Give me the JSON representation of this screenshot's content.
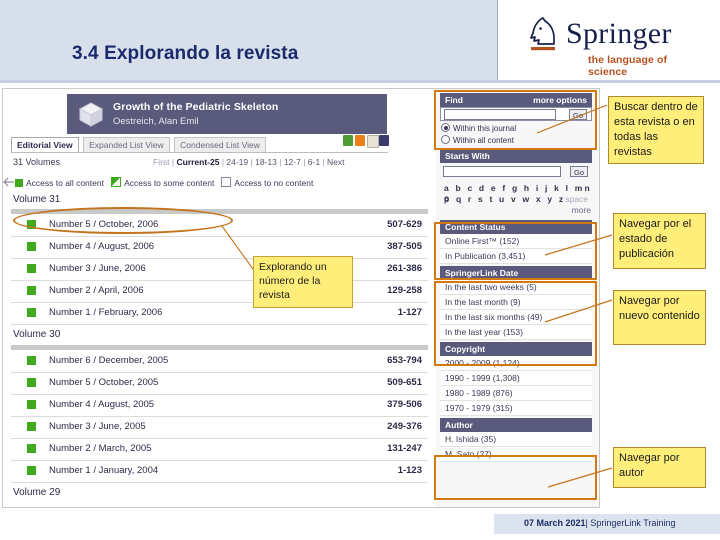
{
  "slide": {
    "title": "3.4 Explorando la revista",
    "brand": {
      "name": "Springer",
      "tagline": "the language of science",
      "logo_icon": "springer-knight-icon",
      "accent_color": "#b4521e",
      "title_color": "#1a2a6b"
    },
    "footer": {
      "date": "07 March 2021",
      "separator": "|",
      "label": "SpringerLink  Training"
    }
  },
  "screenshot": {
    "journal": {
      "title": "Growth of the Pediatric Skeleton",
      "author": "Oestreich, Alan Emil",
      "icon": "book-icon"
    },
    "tabs": [
      {
        "label": "Editorial View",
        "active": true
      },
      {
        "label": "Expanded List View",
        "active": false
      },
      {
        "label": "Condensed List View",
        "active": false
      }
    ],
    "tool_icons": [
      {
        "name": "export-citation-icon",
        "color": "#4f9b37"
      },
      {
        "name": "rss-feed-icon",
        "color": "#ef7f1a"
      },
      {
        "name": "email-icon",
        "color": "#e7e3d6"
      },
      {
        "name": "save-icon",
        "color": "#3b3b6b"
      }
    ],
    "volumes_count": "31 Volumes",
    "pager": {
      "first": "First",
      "sep": "|",
      "items": [
        "Current-25",
        "24-19",
        "18-13",
        "12-7",
        "6-1"
      ],
      "next": "Next"
    },
    "legend": [
      {
        "label": "Access to all content",
        "swatch": "all"
      },
      {
        "label": "Access to some content",
        "swatch": "some"
      },
      {
        "label": "Access to no content",
        "swatch": "none"
      }
    ],
    "back_icon": "back-arrow-icon",
    "volumes": [
      {
        "heading": "Volume 31",
        "issues": [
          {
            "label": "Number 5 / October, 2006",
            "pages": "507-629"
          },
          {
            "label": "Number 4 / August, 2006",
            "pages": "387-505"
          },
          {
            "label": "Number 3 / June, 2006",
            "pages": "261-386"
          },
          {
            "label": "Number 2 / April, 2006",
            "pages": "129-258"
          },
          {
            "label": "Number 1 / February, 2006",
            "pages": "1-127"
          }
        ]
      },
      {
        "heading": "Volume 30",
        "issues": [
          {
            "label": "Number 6 / December, 2005",
            "pages": "653-794"
          },
          {
            "label": "Number 5 / October, 2005",
            "pages": "509-651"
          },
          {
            "label": "Number 4 / August, 2005",
            "pages": "379-506"
          },
          {
            "label": "Number 3 / June, 2005",
            "pages": "249-376"
          },
          {
            "label": "Number 2 / March, 2005",
            "pages": "131-247"
          },
          {
            "label": "Number 1 / January, 2004",
            "pages": "1-123"
          }
        ]
      },
      {
        "heading": "Volume 29",
        "issues": []
      }
    ],
    "facets": {
      "find": {
        "title": "Find",
        "more_options": "more options",
        "input_value": "",
        "go_label": "Go",
        "options": [
          {
            "label": "Within this journal",
            "selected": true
          },
          {
            "label": "Within all content",
            "selected": false
          }
        ]
      },
      "starts_with": {
        "title": "Starts With",
        "input_value": "",
        "go_label": "Go",
        "alphabet_row1": "a b c d e f g h i j k l mn o",
        "alphabet_row2": "p q r s t u v w x y z",
        "space_label": "space",
        "more_label": "more"
      },
      "content_status": {
        "title": "Content Status",
        "items": [
          "Online First™ (152)",
          "In Publication (3,451)"
        ]
      },
      "springerlink_date": {
        "title": "SpringerLink Date",
        "items": [
          "In the last two weeks (5)",
          "In the last month (9)",
          "In the last six months (49)",
          "In the last year (153)"
        ]
      },
      "copyright": {
        "title": "Copyright",
        "items": [
          "2000 - 2009 (1,124)",
          "1990 - 1999 (1,308)",
          "1980 - 1989 (876)",
          "1970 - 1979 (315)"
        ]
      },
      "author": {
        "title": "Author",
        "items": [
          "H. Ishida (35)",
          "M. Sato (27)"
        ]
      }
    }
  },
  "annotations": {
    "highlight_color": "#d2790f",
    "callouts": [
      {
        "id": "search",
        "text": "Buscar dentro de esta revista o en todas las revistas"
      },
      {
        "id": "status",
        "text": "Navegar por el estado de publicación"
      },
      {
        "id": "new",
        "text": "Navegar por nuevo contenido"
      },
      {
        "id": "author",
        "text": "Navegar por autor"
      }
    ],
    "note": {
      "text": "Explorando un número de la revista"
    }
  }
}
